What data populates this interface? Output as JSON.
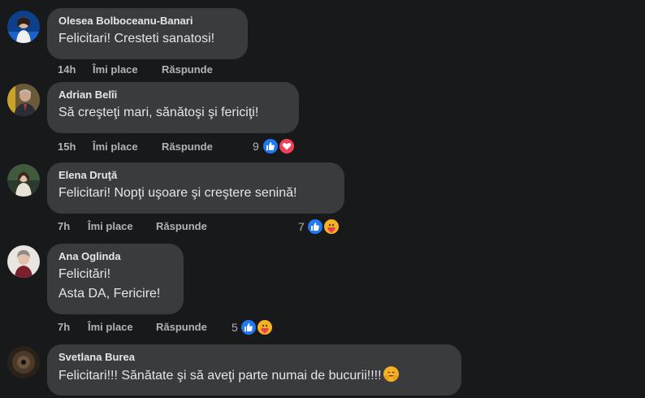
{
  "actions": {
    "like": "Îmi place",
    "reply": "Răspunde"
  },
  "comments": [
    {
      "author": "Olesea Bolboceanu-Banari",
      "lines": [
        "Felicitari! Cresteti sanatosi!"
      ],
      "time": "14h",
      "reaction_count": null,
      "reactions": []
    },
    {
      "author": "Adrian Belîi",
      "lines": [
        "Să creşteţi mari, sănătoşi şi fericiţi!"
      ],
      "time": "15h",
      "reaction_count": "9",
      "reactions": [
        "like",
        "love"
      ]
    },
    {
      "author": "Elena Druţă",
      "lines": [
        "Felicitari! Nopţi uşoare şi creştere senină!"
      ],
      "time": "7h",
      "reaction_count": "7",
      "reactions": [
        "like",
        "care"
      ]
    },
    {
      "author": "Ana Oglinda",
      "lines": [
        "Felicitări!",
        "Asta DA, Fericire!"
      ],
      "time": "7h",
      "reaction_count": "5",
      "reactions": [
        "like",
        "care"
      ]
    },
    {
      "author": "Svetlana Burea",
      "lines": [
        "Felicitari!!! Sănătate şi să aveţi parte numai de bucurii!!!!"
      ],
      "time": null,
      "reaction_count": null,
      "reactions": []
    }
  ],
  "colors": {
    "background": "#18191a",
    "bubble": "#3a3b3c",
    "like": "#2078f4",
    "love": "#f33e58",
    "care": "#f7b125"
  }
}
